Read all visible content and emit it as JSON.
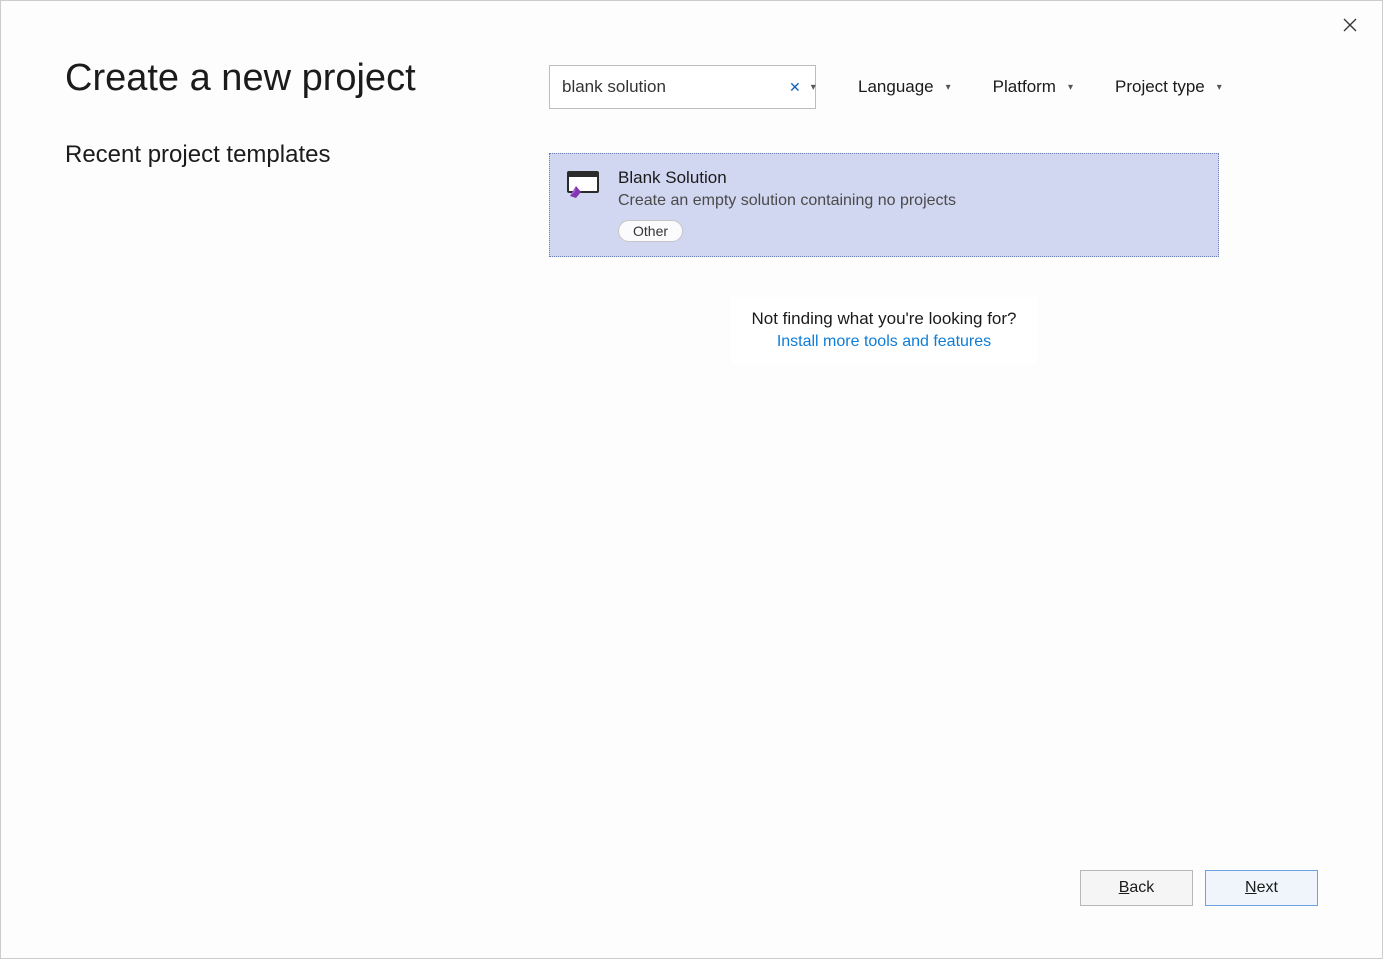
{
  "window": {
    "title": "Create a new project"
  },
  "search": {
    "value": "blank solution"
  },
  "filters": {
    "language": "Language",
    "platform": "Platform",
    "project_type": "Project type"
  },
  "left": {
    "recent_heading": "Recent project templates"
  },
  "templates": [
    {
      "title": "Blank Solution",
      "description": "Create an empty solution containing no projects",
      "tag": "Other"
    }
  ],
  "not_finding": {
    "text": "Not finding what you're looking for?",
    "link": "Install more tools and features"
  },
  "buttons": {
    "back": "Back",
    "next": "Next"
  }
}
